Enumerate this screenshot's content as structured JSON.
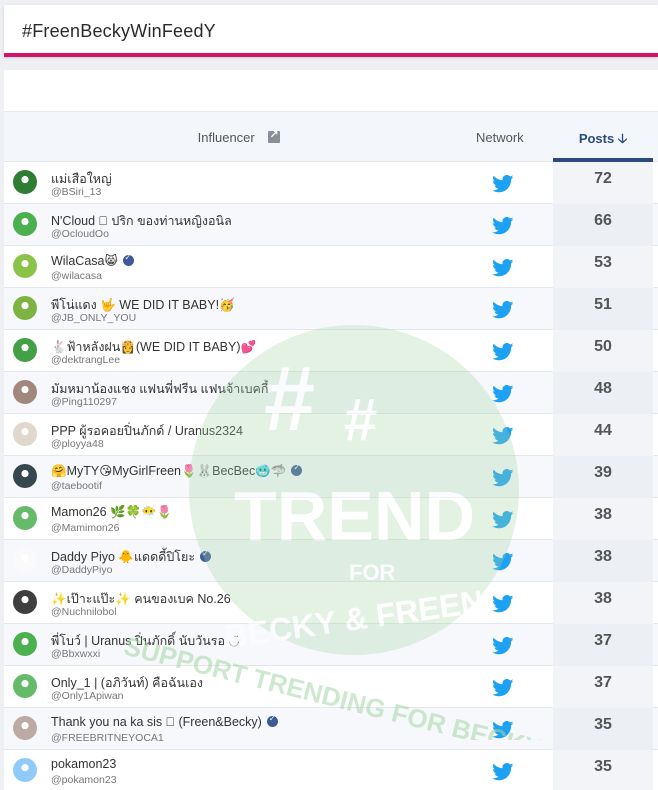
{
  "search": {
    "query": "#FreenBeckyWinFeedY"
  },
  "table": {
    "headers": {
      "influencer": "Influencer",
      "network": "Network",
      "posts": "Posts"
    },
    "rows": [
      {
        "name": "แม่เสือใหญ่",
        "handle": "@BSiri_13",
        "posts": "72",
        "verified": false,
        "avatar_color": "#2e7d32"
      },
      {
        "name": "N'Cloud 󾓥 ปริก ของท่านหญิงอนิล",
        "handle": "@OcloudOo",
        "posts": "66",
        "verified": false,
        "avatar_color": "#4caf50"
      },
      {
        "name": "WilaCasa😸",
        "handle": "@wilacasa",
        "posts": "53",
        "verified": true,
        "avatar_color": "#8bc34a"
      },
      {
        "name": "พีโน่แดง 🤟 WE DID IT BABY!🥳",
        "handle": "@JB_ONLY_YOU",
        "posts": "51",
        "verified": false,
        "avatar_color": "#7cb342"
      },
      {
        "name": "🐇ฟ้าหลังฝน👸(WE DID IT BABY)💕",
        "handle": "@dektrangLee",
        "posts": "50",
        "verified": false,
        "avatar_color": "#43a047"
      },
      {
        "name": "มัมหมาน้องแชง แฟนพี่ฟรีน แฟนจ้าเบคกี้",
        "handle": "@Ping110297",
        "posts": "48",
        "verified": false,
        "avatar_color": "#a1887f"
      },
      {
        "name": "PPP ผู้รอคอยปิ่นภักด์ / Uranus2324",
        "handle": "@ployya48",
        "posts": "44",
        "verified": false,
        "avatar_color": "#e0d8cc"
      },
      {
        "name": "🤗MyTY😘MyGirlFreen🌷🐰BecBec🥶🦈",
        "handle": "@taebootif",
        "posts": "39",
        "verified": true,
        "avatar_color": "#37474f"
      },
      {
        "name": "Mamon26 🌿🍀😶‍🌫️🌷",
        "handle": "@Mamimon26",
        "posts": "38",
        "verified": false,
        "avatar_color": "#66bb6a"
      },
      {
        "name": "Daddy Piyo 🐥แดดดี้ปิโยะ",
        "handle": "@DaddyPiyo",
        "posts": "38",
        "verified": true,
        "avatar_color": "#fafafa"
      },
      {
        "name": "✨เป๊าะแป๊ะ✨ คนของเบค No.26",
        "handle": "@Nuchnilobol",
        "posts": "38",
        "verified": false,
        "avatar_color": "#3e3e3e"
      },
      {
        "name": "พี่โบว์ | Uranus ปิ่นภักดิ์ นับวันรอ ◡̈",
        "handle": "@Bbxwxxi",
        "posts": "37",
        "verified": false,
        "avatar_color": "#4caf50"
      },
      {
        "name": "Only_1 | (อภิวันท์) คือฉันเอง",
        "handle": "@Only1Apiwan",
        "posts": "37",
        "verified": false,
        "avatar_color": "#66bb6a"
      },
      {
        "name": "Thank you na ka sis 󾓥 (Freen&Becky)",
        "handle": "@FREEBRITNEYOCA1",
        "posts": "35",
        "verified": true,
        "avatar_color": "#bcaaa4"
      },
      {
        "name": "pokamon23",
        "handle": "@pokamon23",
        "posts": "35",
        "verified": false,
        "avatar_color": "#90caf9"
      }
    ]
  },
  "colors": {
    "accent": "#d6136b",
    "twitter": "#1da1f2",
    "posts_header": "#2c4a7c",
    "watermark": "#a5d6a7"
  },
  "watermark": {
    "big": "TREND",
    "for": "FOR",
    "line": "BECKY & FREEN",
    "arc": "SUPPORT TRENDING FOR BECKY & FREEN"
  }
}
